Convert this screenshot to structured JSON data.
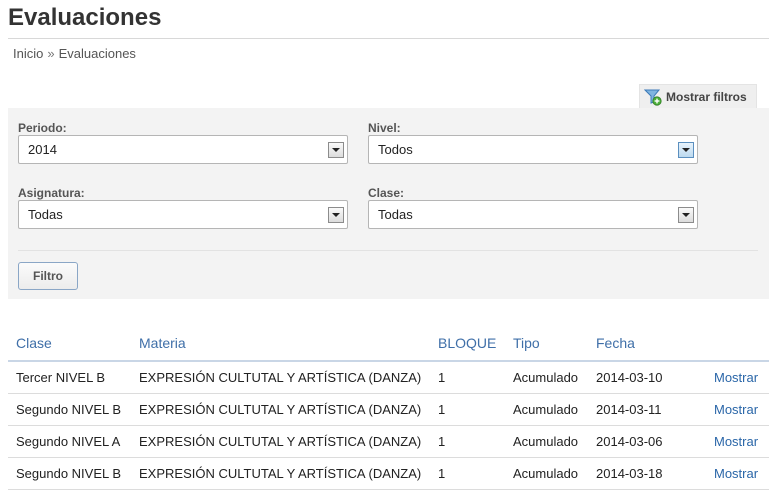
{
  "page": {
    "title": "Evaluaciones"
  },
  "breadcrumb": {
    "home": "Inicio",
    "separator": "»",
    "current": "Evaluaciones"
  },
  "filter_toggle": {
    "label": "Mostrar filtros",
    "icon": "filter-add-icon"
  },
  "filters": {
    "periodo": {
      "label": "Periodo:",
      "value": "2014"
    },
    "nivel": {
      "label": "Nivel:",
      "value": "Todos"
    },
    "asignatura": {
      "label": "Asignatura:",
      "value": "Todas"
    },
    "clase": {
      "label": "Clase:",
      "value": "Todas"
    },
    "submit_label": "Filtro"
  },
  "table": {
    "headers": [
      "Clase",
      "Materia",
      "BLOQUE",
      "Tipo",
      "Fecha"
    ],
    "rows": [
      {
        "clase": "Tercer NIVEL B",
        "materia": "EXPRESIÓN CULTUTAL Y ARTÍSTICA (DANZA)",
        "bloque": "1",
        "tipo": "Acumulado",
        "fecha": "2014-03-10",
        "action": "Mostrar"
      },
      {
        "clase": "Segundo NIVEL B",
        "materia": "EXPRESIÓN CULTUTAL Y ARTÍSTICA (DANZA)",
        "bloque": "1",
        "tipo": "Acumulado",
        "fecha": "2014-03-11",
        "action": "Mostrar"
      },
      {
        "clase": "Segundo NIVEL A",
        "materia": "EXPRESIÓN CULTUTAL Y ARTÍSTICA (DANZA)",
        "bloque": "1",
        "tipo": "Acumulado",
        "fecha": "2014-03-06",
        "action": "Mostrar"
      },
      {
        "clase": "Segundo NIVEL B",
        "materia": "EXPRESIÓN CULTUTAL Y ARTÍSTICA (DANZA)",
        "bloque": "1",
        "tipo": "Acumulado",
        "fecha": "2014-03-18",
        "action": "Mostrar"
      }
    ]
  },
  "colors": {
    "link": "#2a66a8",
    "header_text": "#3f6fa8",
    "panel_bg": "#f3f3f3"
  }
}
